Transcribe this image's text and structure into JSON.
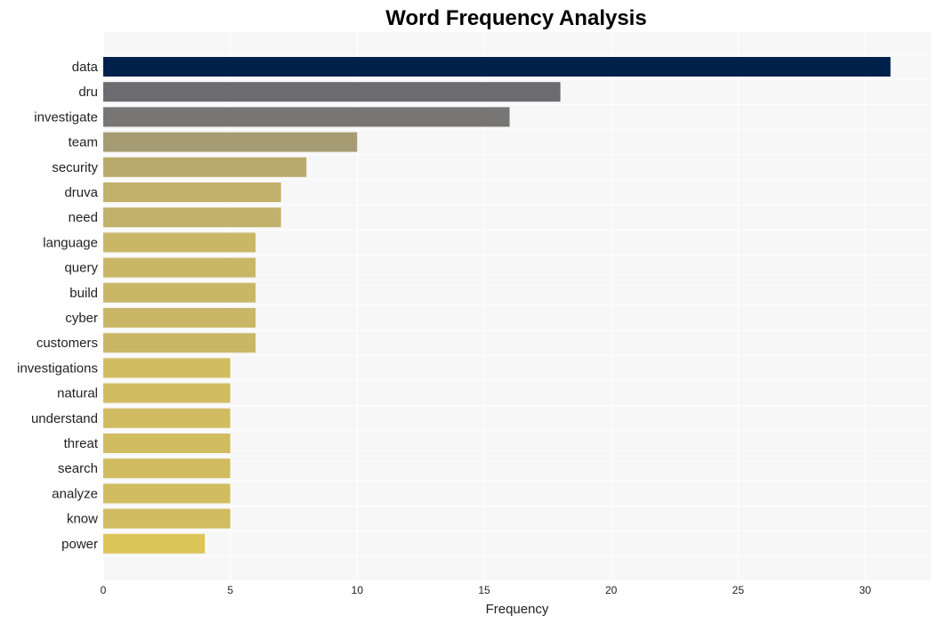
{
  "chart_data": {
    "type": "bar",
    "orientation": "horizontal",
    "title": "Word Frequency Analysis",
    "xlabel": "Frequency",
    "ylabel": "",
    "xlim": [
      0,
      32.6
    ],
    "xticks": [
      0,
      5,
      10,
      15,
      20,
      25,
      30
    ],
    "grid": true,
    "legend": "none",
    "categories": [
      "data",
      "dru",
      "investigate",
      "team",
      "security",
      "druva",
      "need",
      "language",
      "query",
      "build",
      "cyber",
      "customers",
      "investigations",
      "natural",
      "understand",
      "threat",
      "search",
      "analyze",
      "know",
      "power"
    ],
    "values": [
      31,
      18,
      16,
      10,
      8,
      7,
      7,
      6,
      6,
      6,
      6,
      6,
      5,
      5,
      5,
      5,
      5,
      5,
      5,
      4
    ],
    "colors": [
      "#00204c",
      "#6b6b70",
      "#777674",
      "#a69c73",
      "#b9aa6c",
      "#c1b16a",
      "#c1b16a",
      "#c9b767",
      "#c9b767",
      "#c9b767",
      "#c9b767",
      "#c9b767",
      "#d1bc62",
      "#d1bc62",
      "#d1bc62",
      "#d1bc62",
      "#d1bc62",
      "#d1bc62",
      "#d1bc62",
      "#dcc65a"
    ]
  }
}
